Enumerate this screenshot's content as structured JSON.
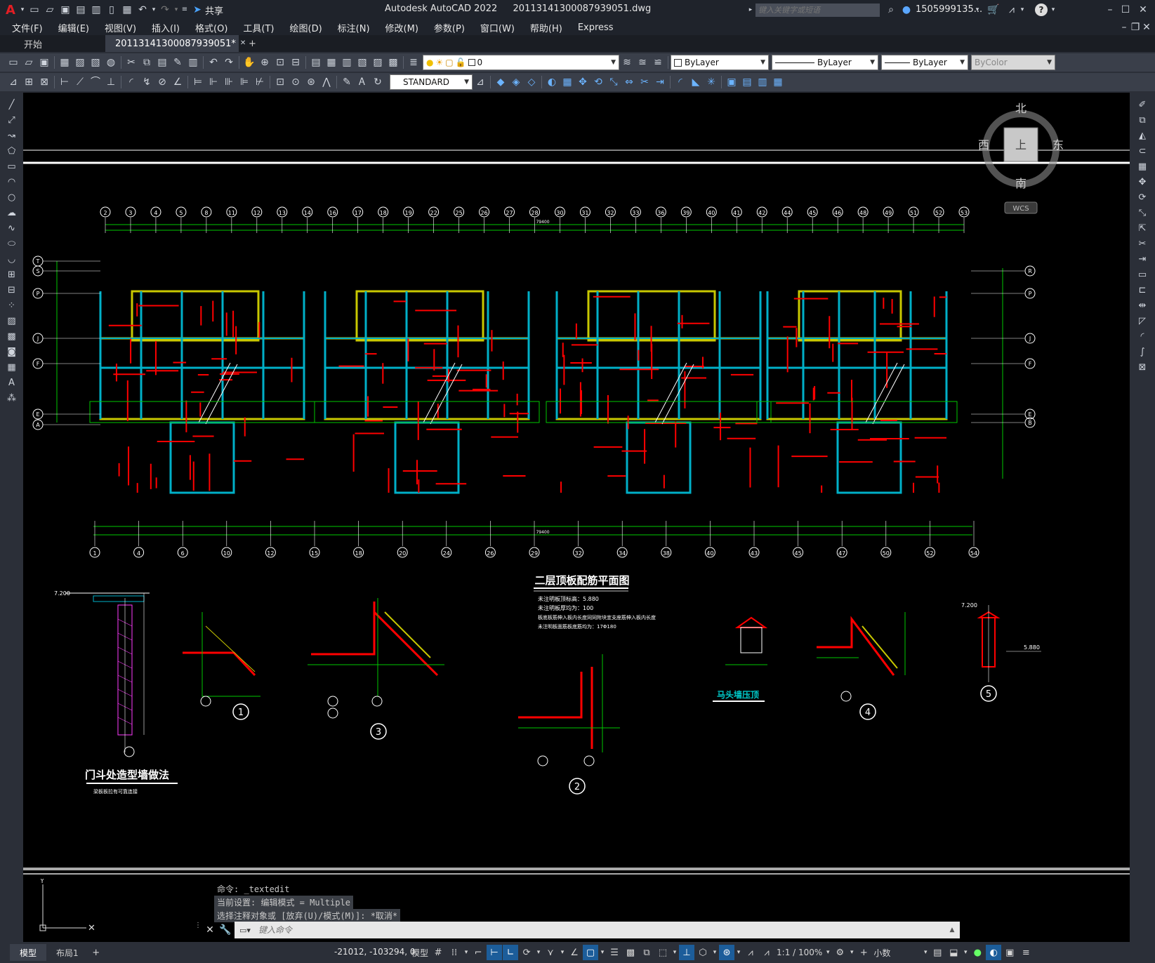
{
  "app": {
    "title": "Autodesk AutoCAD 2022",
    "filename": "20113141300087939051.dwg",
    "logo": "A",
    "share_label": "共享",
    "search_placeholder": "键入关键字或短语",
    "user": "1505999135..."
  },
  "menu": [
    "文件(F)",
    "编辑(E)",
    "视图(V)",
    "插入(I)",
    "格式(O)",
    "工具(T)",
    "绘图(D)",
    "标注(N)",
    "修改(M)",
    "参数(P)",
    "窗口(W)",
    "帮助(H)",
    "Express"
  ],
  "tabs": {
    "start": "开始",
    "active": "20113141300087939051*",
    "add": "+"
  },
  "properties": {
    "layer": "0",
    "color": "ByLayer",
    "linetype": "ByLayer",
    "lineweight": "ByLayer",
    "plotstyle": "ByColor",
    "textstyle": "STANDARD"
  },
  "viewcube": {
    "north": "北",
    "south": "南",
    "east": "东",
    "west": "西",
    "face": "上",
    "wcs": "WCS"
  },
  "drawing": {
    "plan_title": "二层顶板配筋平面图",
    "notes": [
      "未注明板顶标高：5.880",
      "未注明板厚均为：100",
      "板底板筋伸入板内长度同同附块宜支座筋伸入板内长度",
      "未注明板面筋板底筋均为：17Φ180"
    ],
    "top_axes": [
      "2",
      "3",
      "4",
      "5",
      "8",
      "11",
      "12",
      "13",
      "14",
      "16",
      "17",
      "18",
      "19",
      "22",
      "25",
      "26",
      "27",
      "28",
      "30",
      "31",
      "32",
      "33",
      "36",
      "39",
      "40",
      "41",
      "42",
      "44",
      "45",
      "46",
      "48",
      "49",
      "51",
      "52",
      "53"
    ],
    "bottom_axes": [
      "1",
      "4",
      "6",
      "10",
      "12",
      "15",
      "18",
      "20",
      "24",
      "26",
      "29",
      "32",
      "34",
      "38",
      "40",
      "43",
      "45",
      "47",
      "50",
      "52",
      "54"
    ],
    "left_axes": [
      "T",
      "S",
      "P",
      "J",
      "F",
      "E",
      "A"
    ],
    "right_axes": [
      "R",
      "P",
      "J",
      "F",
      "E",
      "B"
    ],
    "overall_dim": "79400",
    "detail_numbers": [
      "1",
      "3",
      "2",
      "4",
      "5"
    ],
    "detail_door": "门斗处造型墙做法",
    "detail_door_sub": "梁板板拉有可靠连接",
    "detail_parapet": "马头墙压顶",
    "elev_a": "7.200",
    "elev_b": "5.880"
  },
  "command": {
    "history": [
      "命令: _textedit",
      "当前设置: 编辑模式 = Multiple",
      "选择注释对象或 [放弃(U)/模式(M)]: *取消*"
    ],
    "placeholder": "键入命令"
  },
  "status": {
    "model_tab": "模型",
    "layout_tab": "布局1",
    "coords": "-21012, -103294, 0",
    "mode": "模型",
    "scale": "1:1 / 100%",
    "units": "小数"
  },
  "ucs": {
    "y": "Y"
  },
  "colors": {
    "red": "#ff0000",
    "cyan": "#00b0c8",
    "yellow": "#c8c800",
    "green": "#00c800",
    "white": "#ffffff",
    "status_on": "#1c5d9a"
  }
}
